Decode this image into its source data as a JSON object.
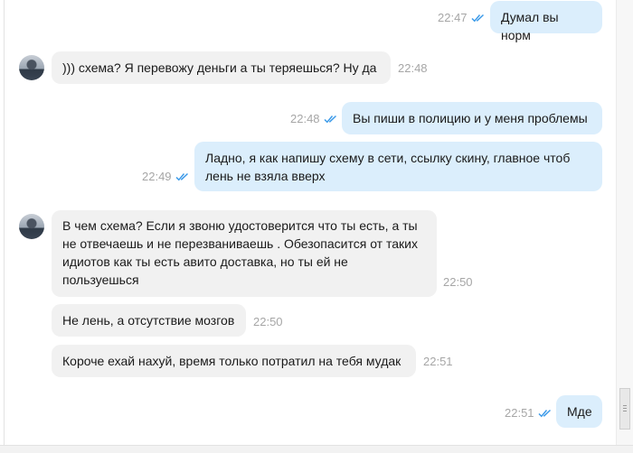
{
  "messages": [
    {
      "id": "m1",
      "dir": "out",
      "text": "Думал вы норм",
      "time": "22:47",
      "read": true
    },
    {
      "id": "m2",
      "dir": "in",
      "text": "))) схема? Я перевожу деньги а ты теряешься? Ну да",
      "time": "22:48",
      "avatar": true
    },
    {
      "id": "m3",
      "dir": "out",
      "text": "Вы пиши в полицию и у меня проблемы",
      "time": "22:48",
      "read": true
    },
    {
      "id": "m4",
      "dir": "out",
      "text": "Ладно, я как напишу схему в сети, ссылку скину, главное чтоб\nлень не взяла вверх",
      "time": "22:49",
      "read": true
    },
    {
      "id": "m5",
      "dir": "in",
      "text": "В чем схема? Если я звоню удостоверится что ты есть, а ты\nне отвечаешь и не перезваниваешь . Обезопасится от таких\nидиотов как ты есть авито доставка, но ты ей не\nпользуешься",
      "time": "22:50",
      "avatar": true
    },
    {
      "id": "m6",
      "dir": "in",
      "text": "Не лень, а отсутствие мозгов",
      "time": "22:50"
    },
    {
      "id": "m7",
      "dir": "in",
      "text": "Короче ехай нахуй, время только потратил на тебя мудак",
      "time": "22:51"
    },
    {
      "id": "m8",
      "dir": "out",
      "text": "Мде",
      "time": "22:51",
      "read": true
    }
  ],
  "colors": {
    "incoming_bubble": "#f1f1f1",
    "outgoing_bubble": "#dbeefc",
    "read_check": "#3d9be9",
    "time": "#a6a6a6"
  },
  "icons": {
    "read_receipt": "double-check-icon",
    "avatar": "user-avatar"
  }
}
